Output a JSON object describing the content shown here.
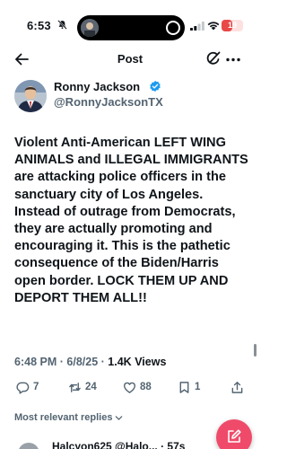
{
  "status_bar": {
    "time": "6:53",
    "battery_level": "19",
    "battery_color": "#e84848"
  },
  "header": {
    "title": "Post"
  },
  "author": {
    "name": "Ronny Jackson",
    "handle": "@RonnyJacksonTX",
    "verified_color": "#1d9bf0"
  },
  "post": {
    "text": "Violent Anti-American LEFT WING ANIMALS and ILLEGAL IMMIGRANTS are attacking police officers in the sanctuary city of Los Angeles. Instead of outrage from Democrats, they are actually promoting and encouraging it. This is the pathetic consequence of the Biden/Harris open border. LOCK THEM UP AND DEPORT THEM ALL!!",
    "time": "6:48 PM",
    "date": "6/8/25",
    "views_count": "1.4K",
    "views_label": "Views",
    "separator": "·"
  },
  "actions": {
    "replies": "7",
    "reposts": "24",
    "likes": "88",
    "bookmarks": "1"
  },
  "replies_filter": {
    "label": "Most relevant replies"
  },
  "reply_peek": {
    "text": "Halcyon625 @Halo... · 57s"
  },
  "icons": {
    "back": "arrow-left-icon",
    "grok": "grok-icon",
    "more": "more-horizontal-icon",
    "reply": "reply-bubble-icon",
    "repost": "repost-icon",
    "like": "heart-icon",
    "bookmark": "bookmark-icon",
    "share": "share-icon",
    "compose": "compose-icon"
  },
  "colors": {
    "accent": "#1d9bf0",
    "fab": "#f04a6a",
    "secondary_text": "#536471"
  }
}
